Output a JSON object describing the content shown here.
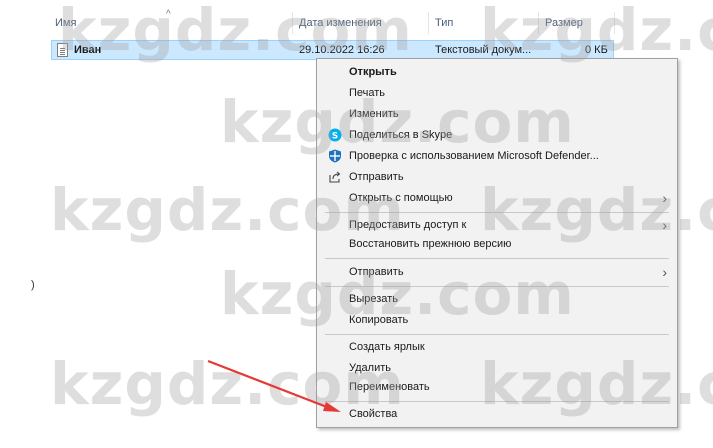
{
  "columns": {
    "name": "Имя",
    "date": "Дата изменения",
    "type": "Тип",
    "size": "Размер"
  },
  "file": {
    "name": "Иван",
    "date": "29.10.2022 16:26",
    "type": "Текстовый докум...",
    "size": "0 КБ"
  },
  "stray_text": ")",
  "watermark": "kzgdz.com",
  "context_menu": {
    "items": {
      "open": "Открыть",
      "print": "Печать",
      "edit": "Изменить",
      "share_skype": "Поделиться в Skype",
      "defender": "Проверка с использованием Microsoft Defender...",
      "send": "Отправить",
      "open_with": "Открыть с помощью",
      "grant_access": "Предоставить доступ к",
      "restore": "Восстановить прежнюю версию",
      "send_to": "Отправить",
      "cut": "Вырезать",
      "copy": "Копировать",
      "shortcut": "Создать ярлык",
      "delete": "Удалить",
      "rename": "Переименовать",
      "properties": "Свойства"
    }
  },
  "colors": {
    "selection": "#cce8ff",
    "selection_border": "#99d1ff",
    "menu_bg": "#f2f2f2",
    "arrow": "#e53935",
    "skype": "#00aff0",
    "defender": "#1e73be"
  }
}
